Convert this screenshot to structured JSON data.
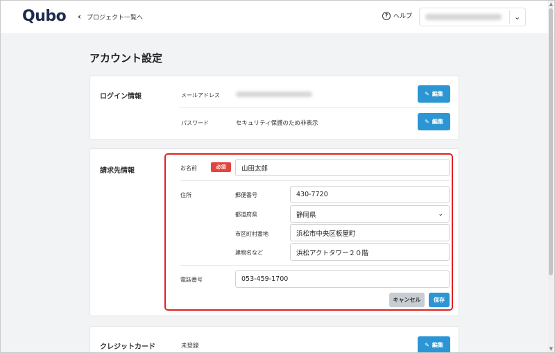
{
  "header": {
    "logo": "Qubo",
    "back_label": "プロジェクト一覧へ",
    "help_label": "ヘルプ"
  },
  "page": {
    "title": "アカウント設定"
  },
  "login_card": {
    "title": "ログイン情報",
    "email_label": "メールアドレス",
    "password_label": "パスワード",
    "password_value": "セキュリティ保護のため非表示",
    "edit_label": "編集"
  },
  "billing_card": {
    "title": "請求先情報",
    "name_label": "お名前",
    "required_badge": "必須",
    "name_value": "山田太郎",
    "address_label": "住所",
    "postal_label": "郵便番号",
    "postal_value": "430-7720",
    "prefecture_label": "都道府県",
    "prefecture_value": "静岡県",
    "city_label": "市区町村番地",
    "city_value": "浜松市中央区板屋町",
    "building_label": "建物名など",
    "building_value": "浜松アクトタワー２０階",
    "phone_label": "電話番号",
    "phone_value": "053-459-1700",
    "cancel_label": "キャンセル",
    "save_label": "保存"
  },
  "card_card": {
    "title": "クレジットカード",
    "status": "未登録",
    "edit_label": "編集"
  },
  "icons": {
    "back": "chevron-left-icon",
    "help": "question-circle-icon",
    "account": "chevron-down-icon",
    "edit": "pencil-icon",
    "select": "chevron-down-icon"
  },
  "colors": {
    "primary": "#2b96d3",
    "required": "#e0463f",
    "highlight": "#e02020"
  }
}
